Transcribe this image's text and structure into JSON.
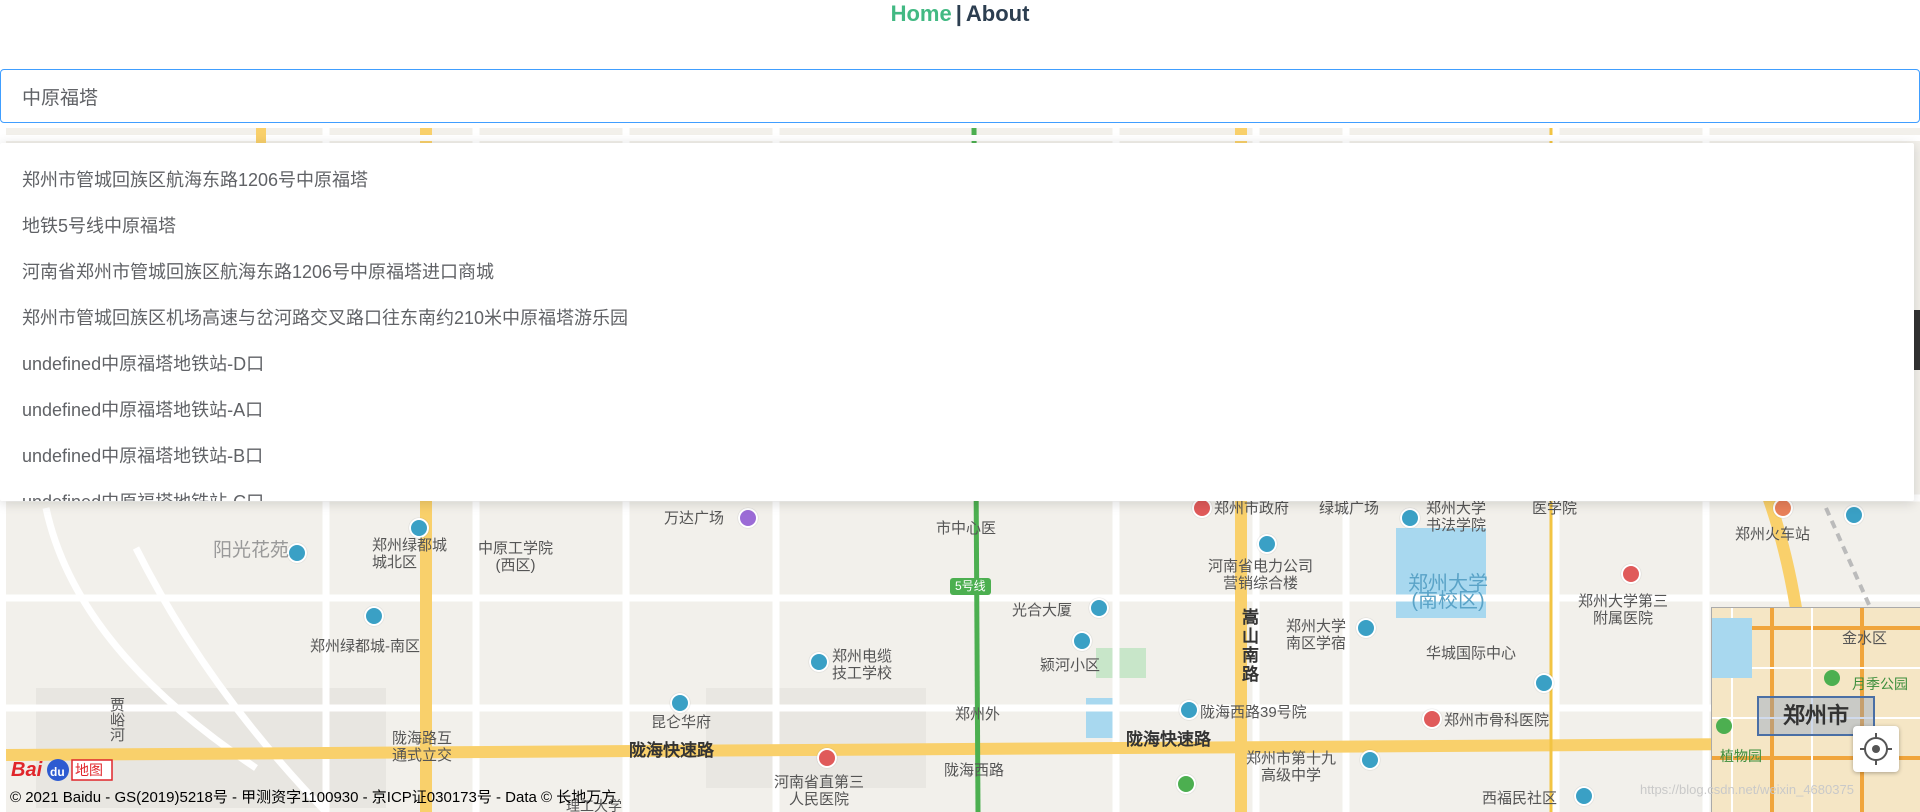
{
  "nav": {
    "home": "Home",
    "separator": "|",
    "about": "About"
  },
  "search": {
    "value": "中原福塔",
    "placeholder": ""
  },
  "suggestions": [
    "郑州市管城回族区航海东路1206号中原福塔",
    "地铁5号线中原福塔",
    "河南省郑州市管城回族区航海东路1206号中原福塔进口商城",
    "郑州市管城回族区机场高速与岔河路交叉路口往东南约210米中原福塔游乐园",
    "undefined中原福塔地铁站-D口",
    "undefined中原福塔地铁站-A口",
    "undefined中原福塔地铁站-B口",
    "undefined中原福塔地铁站-C口"
  ],
  "map": {
    "labels": {
      "yangguang": "阳光花苑",
      "lvdu_bei": "郑州绿都城\n城北区",
      "zhongyuan_gongxue": "中原工学院\n(西区)",
      "wanda": "万达广场",
      "shizhongxin": "市中心医",
      "zhengfu": "郑州市政府",
      "lvcheng": "绿城广场",
      "shufa": "郑州大学\n书法学院",
      "yixue": "医学院",
      "huochezhan": "郑州火车站",
      "dianli": "河南省电力公司\n营销综合楼",
      "daxue_nan": "郑州大学\n(南校区)",
      "fushu": "郑州大学第三\n附属医院",
      "lvdu_nan": "郑州绿都城-南区",
      "guanghe": "光合大厦",
      "yinghe": "颍河小区",
      "songshan": "嵩\n山\n南\n路",
      "dianlan": "郑州电缆\n技工学校",
      "nanqu_xuesu": "郑州大学\n南区学宿",
      "huacheng": "华城国际中心",
      "kunlun": "昆仑华府",
      "zhengzhouwai": "郑州外",
      "longhai39": "陇海西路39号院",
      "guke": "郑州市骨科医院",
      "jiayu": "贾\n峪\n河",
      "longhaihu": "陇海路互\n通式立交",
      "longhai_kuaisu1": "陇海快速路",
      "longhai_kuaisu2": "陇海快速路",
      "renmin": "河南省直第三\n人民医院",
      "longhaixi": "陇海西路",
      "shijiu": "郑州市第十九\n高级中学",
      "xifumin": "西福民社区",
      "line5": "5号线",
      "lizhi": "理工大学"
    },
    "overview": {
      "city": "郑州市",
      "jinshui": "金水区",
      "yueji": "月季公园",
      "zhiwu": "植物园"
    }
  },
  "footer": {
    "copyright": "© 2021 Baidu - GS(2019)5218号 - 甲测资字1100930 - 京ICP证030173号 - Data © 长地万方",
    "logo": "Bai地图",
    "watermark": "https://blog.csdn.net/weixin_4680375"
  },
  "colors": {
    "nav_home": "#42b983",
    "nav_about": "#2c3e50",
    "input_border": "#409eff",
    "suggestion_text": "#606266",
    "map_bg": "#f2f0eb",
    "highway": "#f9d06b",
    "metro_line5": "#4caf50"
  }
}
